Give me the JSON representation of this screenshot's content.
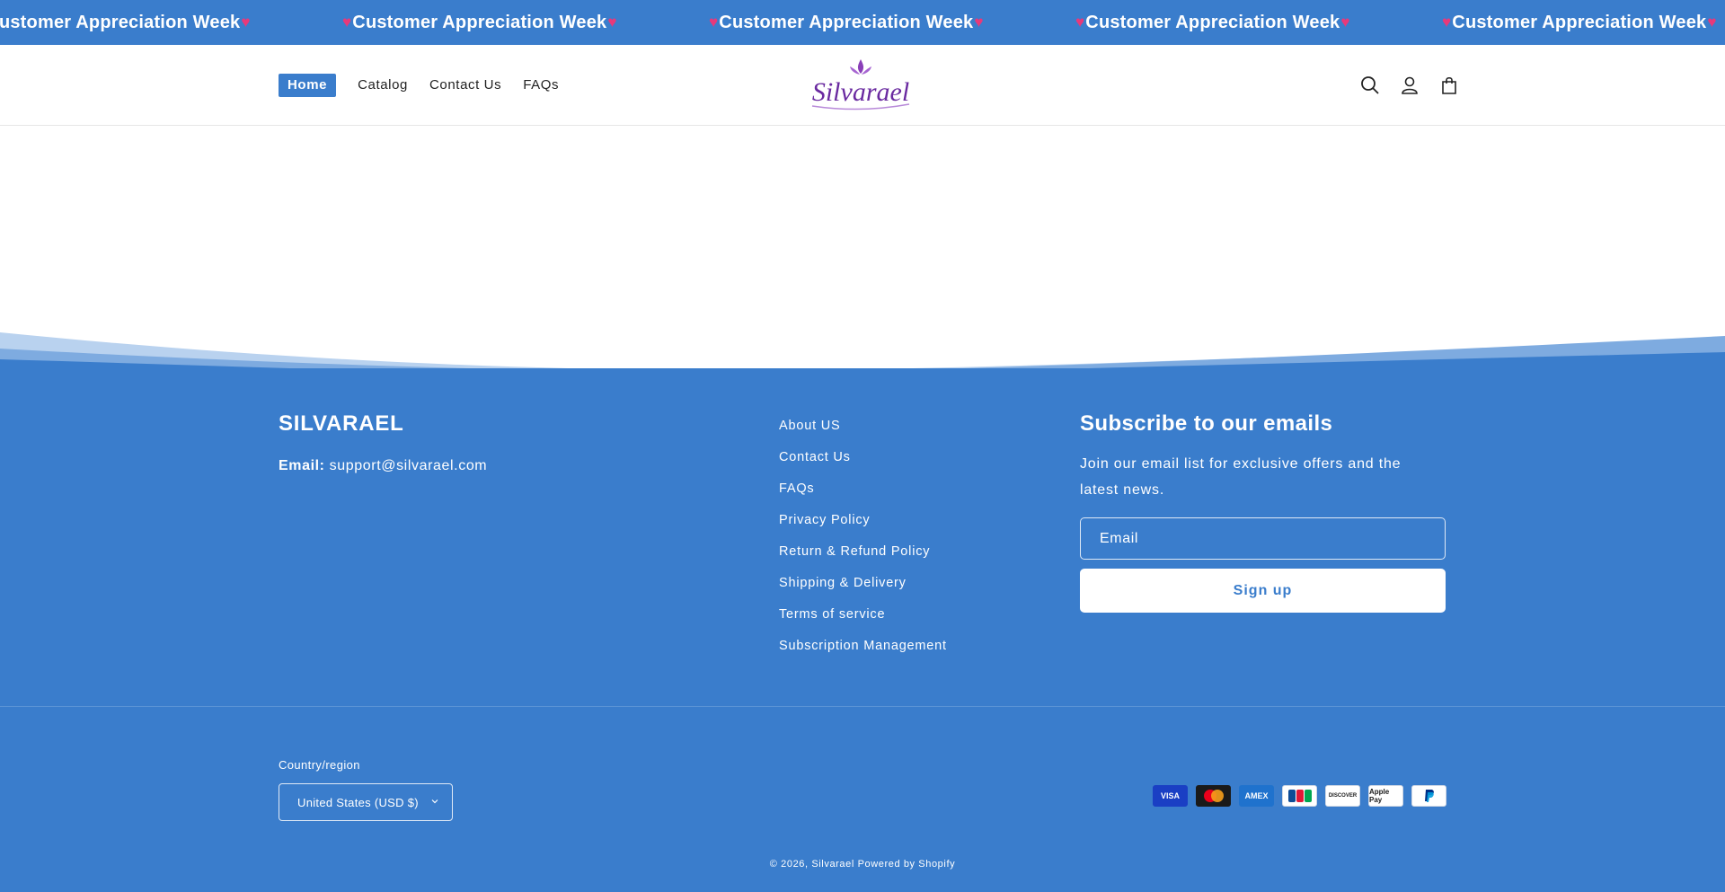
{
  "announcement": {
    "text": "Customer Appreciation Week",
    "items": [
      "Customer Appreciation Week",
      "Customer Appreciation Week",
      "Customer Appreciation Week",
      "Customer Appreciation Week",
      "Customer Appreciation Week",
      "Customer Appreciation Week",
      "Customer Appreciation Week",
      "Customer Appreciation Week",
      "Customer Appreciation Week"
    ],
    "heart_color": "#e8397a"
  },
  "header": {
    "nav": [
      {
        "label": "Home",
        "active": true
      },
      {
        "label": "Catalog",
        "active": false
      },
      {
        "label": "Contact Us",
        "active": false
      },
      {
        "label": "FAQs",
        "active": false
      }
    ],
    "logo_text": "Silvarael",
    "icons": [
      "search-icon",
      "account-icon",
      "cart-icon"
    ]
  },
  "footer": {
    "brand": "SILVARAEL",
    "email_label": "Email:",
    "email_value": "support@silvarael.com",
    "links": [
      "About US",
      "Contact Us",
      "FAQs",
      "Privacy Policy",
      "Return & Refund Policy",
      "Shipping & Delivery",
      "Terms of service",
      "Subscription Management"
    ],
    "subscribe": {
      "title": "Subscribe to our emails",
      "text": "Join our email list for exclusive offers and the latest news.",
      "email_placeholder": "Email",
      "button": "Sign up"
    },
    "country_label": "Country/region",
    "country_value": "United States (USD $)",
    "payments": [
      "VISA",
      "Mastercard",
      "AMEX",
      "JCB",
      "DISCOVER",
      "Apple Pay",
      "PayPal"
    ],
    "copyright": "© 2026, Silvarael Powered by Shopify"
  },
  "colors": {
    "accent": "#3a7dcc",
    "white": "#ffffff"
  }
}
